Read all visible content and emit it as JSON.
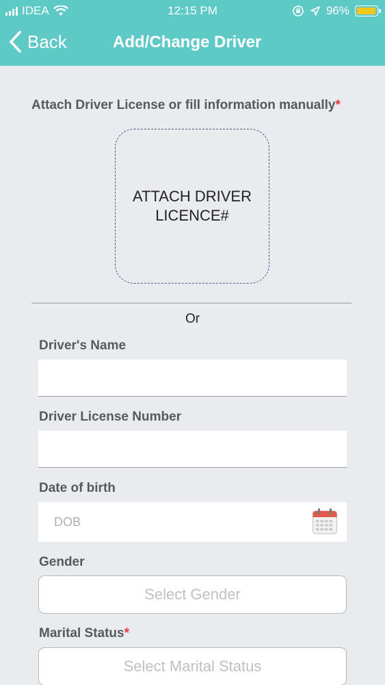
{
  "status_bar": {
    "carrier": "IDEA",
    "time": "12:15 PM",
    "battery": "96%",
    "battery_level": 0.96,
    "icons": [
      "signal-icon",
      "wifi-icon",
      "orientation-lock-icon",
      "location-icon",
      "battery-icon"
    ]
  },
  "nav": {
    "back_label": "Back",
    "title": "Add/Change Driver"
  },
  "attach": {
    "heading": "Attach Driver License or fill information manually",
    "required_mark": "*",
    "box_line1": "ATTACH DRIVER",
    "box_line2": "LICENCE#"
  },
  "separator_text": "Or",
  "fields": {
    "driver_name": {
      "label": "Driver's Name",
      "value": ""
    },
    "license_number": {
      "label": "Driver License Number",
      "value": ""
    },
    "dob": {
      "label": "Date of birth",
      "placeholder": "DOB",
      "value": ""
    },
    "gender": {
      "label": "Gender",
      "placeholder": "Select Gender"
    },
    "marital_status": {
      "label": "Marital Status",
      "required_mark": "*",
      "placeholder": "Select Marital Status"
    }
  },
  "colors": {
    "header": "#5fc9c8",
    "background": "#e9ebee",
    "required": "#e23a3a",
    "calendar_red": "#e05b4b"
  }
}
